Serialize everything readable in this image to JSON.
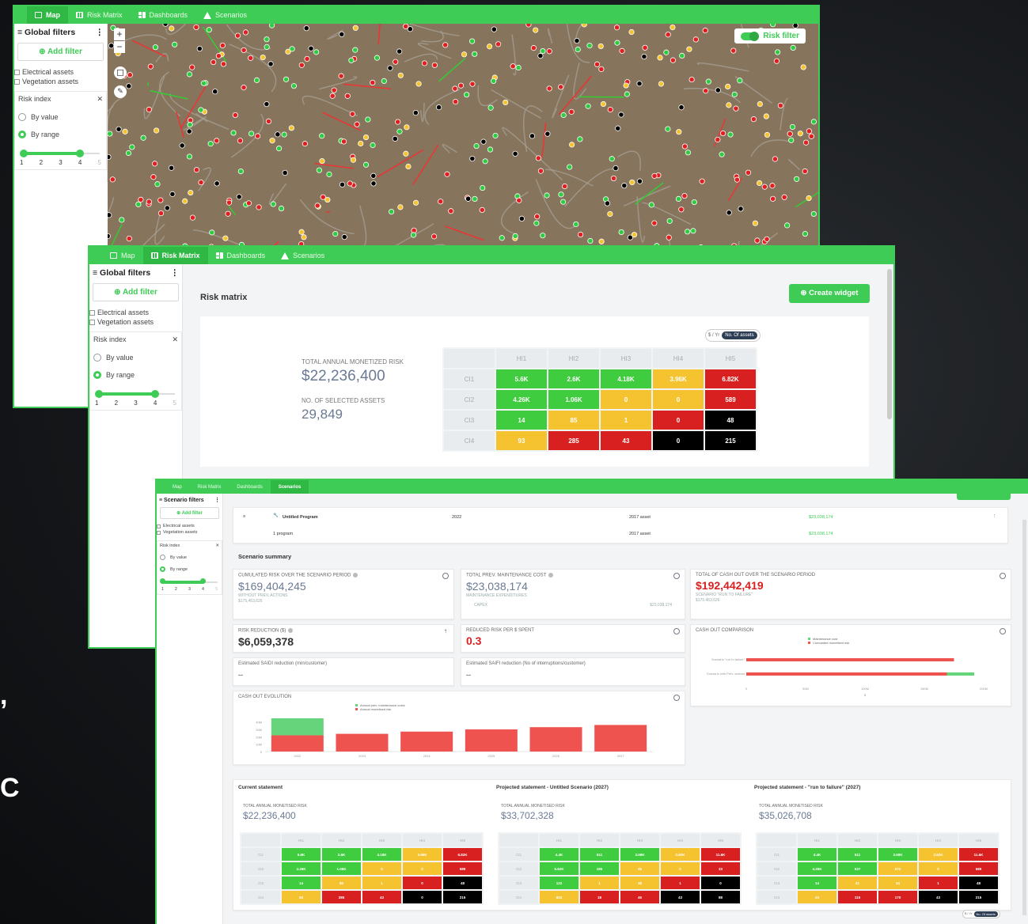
{
  "nav": {
    "map": "Map",
    "risk_matrix": "Risk Matrix",
    "dashboards": "Dashboards",
    "scenarios": "Scenarios"
  },
  "filters": {
    "title": "Global filters",
    "scenario_title": "Scenario filters",
    "add": "Add filter",
    "electrical": "Electrical assets",
    "vegetation": "Vegetation assets",
    "risk_index": "Risk index",
    "by_value": "By value",
    "by_range": "By range",
    "ticks": [
      "1",
      "2",
      "3",
      "4",
      "5"
    ],
    "range": [
      1,
      4
    ]
  },
  "map": {
    "toggle": "Risk filter",
    "zoom_in": "+",
    "zoom_out": "−"
  },
  "risk_matrix": {
    "title": "Risk matrix",
    "create": "Create widget",
    "toggle_a": "$ / Yr",
    "toggle_b": "No. Of assets",
    "total_label": "TOTAL ANNUAL MONETIZED RISK",
    "total": "$22,236,400",
    "assets_label": "NO. OF SELECTED ASSETS",
    "assets": "29,849"
  },
  "matrix_cols": [
    "HI1",
    "HI2",
    "HI3",
    "HI4",
    "HI5"
  ],
  "matrix_rows": [
    "CI1",
    "CI2",
    "CI3",
    "CI4"
  ],
  "matrix_main": [
    [
      "5.6K",
      "2.6K",
      "4.18K",
      "3.96K",
      "6.82K"
    ],
    [
      "4.26K",
      "1.06K",
      "0",
      "0",
      "589"
    ],
    [
      "14",
      "85",
      "1",
      "0",
      "48"
    ],
    [
      "93",
      "285",
      "43",
      "0",
      "215"
    ]
  ],
  "matrix_colors": [
    [
      "g",
      "g",
      "g",
      "y",
      "r"
    ],
    [
      "g",
      "g",
      "y",
      "y",
      "r"
    ],
    [
      "g",
      "y",
      "y",
      "r",
      "k"
    ],
    [
      "y",
      "r",
      "r",
      "k",
      "k"
    ]
  ],
  "scenario": {
    "program": "Untitled Program",
    "year": "2022",
    "asset": "2017 asset",
    "amount": "$23,038,174",
    "count": "1 program",
    "asset2": "2017 asset",
    "amount2": "$23,038,174",
    "summary": "Scenario summary",
    "cum_label": "CUMULATED RISK OVER THE SCENARIO PERIOD",
    "cum": "$169,404,245",
    "cum_sub": "WITHOUT PREV. ACTIONS",
    "cum_sub2": "$175,463,626",
    "prev_label": "TOTAL PREV. MAINTENANCE COST",
    "prev": "$23,038,174",
    "prev_sub": "MAINTENANCE EXPENDITURES",
    "capex": "CAPEX",
    "capex_val": "$23,038,174",
    "cash_label": "TOTAL OF CASH OUT OVER THE SCENARIO PERIOD",
    "cash": "$192,442,419",
    "cash_sub": "SCENARIO \"RUN TO FAILURE\"",
    "cash_sub2": "$175,463,626",
    "rr_label": "RISK REDUCTION ($)",
    "rr": "$6,059,378",
    "rrps_label": "REDUCED RISK PER $ SPENT",
    "rrps": "0.3",
    "saidi_label": "Estimated SAIDI reduction (min/customer)",
    "saidi": "--",
    "saifi_label": "Estimated SAIFI reduction (No of interruptions/customer)",
    "saifi": "--",
    "cmp_label": "CASH OUT COMPARISON",
    "evo_label": "CASH OUT EVOLUTION"
  },
  "chart_data": [
    {
      "type": "bar",
      "title": "CASH OUT EVOLUTION",
      "categories": [
        "2022",
        "2023",
        "2024",
        "2025",
        "2026",
        "2027"
      ],
      "series": [
        {
          "name": "Annual monetised risk",
          "values": [
            22,
            24,
            27,
            30,
            33,
            36
          ]
        },
        {
          "name": "Annual prev. maintenance costs",
          "values": [
            23,
            0,
            0,
            0,
            0,
            0
          ]
        }
      ],
      "yticks": [
        "0",
        "10M",
        "20M",
        "30M",
        "40M"
      ],
      "ylim": [
        0,
        45
      ],
      "legend": "top"
    },
    {
      "type": "bar",
      "title": "CASH OUT COMPARISON",
      "categories": [
        "Scenario \"run to failure\"",
        "Scenario with Prev. actions"
      ],
      "series": [
        {
          "name": "Maintenance cost",
          "values": [
            0,
            23
          ]
        },
        {
          "name": "Cumulated monetised risk",
          "values": [
            175,
            169
          ]
        }
      ],
      "xticks": [
        "0",
        "50M",
        "100M",
        "150M",
        "200M"
      ],
      "xlim": [
        0,
        200
      ],
      "xlabel": "$",
      "legend": "top"
    }
  ],
  "statements": [
    {
      "title": "Current statement",
      "label": "TOTAL ANNUAL MONETISED RISK",
      "value": "$22,236,400",
      "cells": [
        [
          "5.6K",
          "2.6K",
          "4.18K",
          "3.96K",
          "6.82K"
        ],
        [
          "4.26K",
          "1.06K",
          "0",
          "0",
          "589"
        ],
        [
          "14",
          "85",
          "1",
          "0",
          "48"
        ],
        [
          "93",
          "285",
          "43",
          "0",
          "215"
        ]
      ]
    },
    {
      "title": "Projected statement - Untitled Scenario (2027)",
      "label": "TOTAL ANNUAL MONETISED RISK",
      "value": "$33,702,328",
      "cells": [
        [
          "4.4K",
          "511",
          "3.59K",
          "2.62K",
          "11.6K"
        ],
        [
          "5.62K",
          "185",
          "35",
          "0",
          "33"
        ],
        [
          "122",
          "1",
          "38",
          "1",
          "0"
        ],
        [
          "603",
          "18",
          "45",
          "43",
          "88"
        ]
      ]
    },
    {
      "title": "Projected statement - \"run to failure\" (2027)",
      "label": "TOTAL ANNUAL MONETISED RISK",
      "value": "$35,026,708",
      "cells": [
        [
          "4.4K",
          "511",
          "3.59K",
          "2.62K",
          "11.6K"
        ],
        [
          "4.26K",
          "537",
          "572",
          "0",
          "589"
        ],
        [
          "14",
          "41",
          "34",
          "1",
          "48"
        ],
        [
          "23",
          "115",
          "170",
          "43",
          "215"
        ]
      ]
    }
  ],
  "colors": {
    "accent": "#3fcc56",
    "green": "#3fcc3f",
    "yellow": "#f5c330",
    "red": "#d92020",
    "black": "#000000",
    "chart_red": "#ef5350",
    "chart_green": "#66d47a"
  }
}
